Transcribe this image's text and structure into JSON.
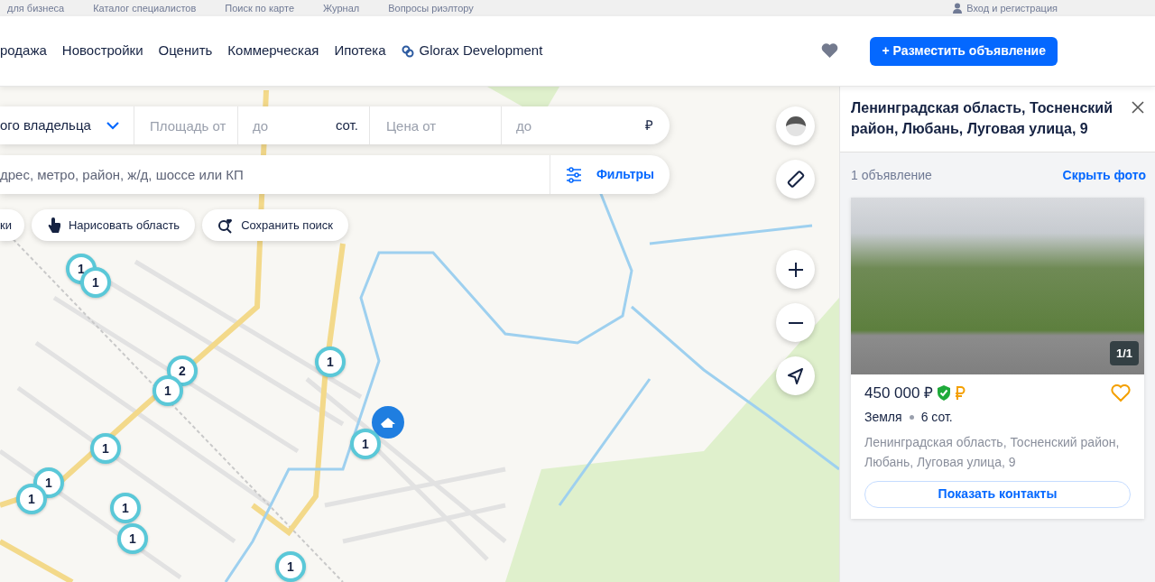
{
  "top_links": [
    "для бизнеса",
    "Каталог специалистов",
    "Поиск по карте",
    "Журнал",
    "Вопросы риэлтору"
  ],
  "login": "Вход и регистрация",
  "nav": [
    {
      "label": "родажа",
      "kind": "text"
    },
    {
      "label": "Новостройки",
      "kind": "text"
    },
    {
      "label": "Оценить",
      "kind": "text"
    },
    {
      "label": "Коммерческая",
      "kind": "text"
    },
    {
      "label": "Ипотека",
      "kind": "text"
    },
    {
      "label": "Glorax Development",
      "kind": "brand"
    }
  ],
  "post_button": "+ Разместить объявление",
  "filters": {
    "owner": "ого владельца",
    "area_from": {
      "placeholder": "Площадь от"
    },
    "area_to": {
      "placeholder": "до"
    },
    "area_unit": "сот.",
    "price_from": {
      "placeholder": "Цена от"
    },
    "price_to": {
      "placeholder": "до"
    },
    "currency": "₽",
    "search_placeholder": "дрес, метро, район, ж/д, шоссе или КП",
    "filters_button": "Фильтры"
  },
  "chips": [
    {
      "label": "ки",
      "kind": "plain"
    },
    {
      "label": "Нарисовать область",
      "kind": "draw"
    },
    {
      "label": "Сохранить поиск",
      "kind": "save"
    }
  ],
  "markers": [
    {
      "count": "1"
    },
    {
      "count": "1"
    },
    {
      "count": "2"
    },
    {
      "count": "1"
    },
    {
      "count": "1"
    },
    {
      "count": "1"
    },
    {
      "count": "1"
    },
    {
      "count": "1"
    },
    {
      "count": "1"
    },
    {
      "count": "1"
    },
    {
      "count": "1"
    },
    {
      "count": "1"
    }
  ],
  "panel": {
    "title": "Ленинградская область, Тосненский район, Любань, Луговая улица, 9",
    "count": "1 объявление",
    "hide_photo": "Скрыть фото",
    "listing": {
      "photo_counter": "1/1",
      "price": "450 000 ₽",
      "verified": true,
      "type": "Земля",
      "area": "6 сот.",
      "address": "Ленинградская область, Тосненский район, Любань, Луговая улица, 9",
      "favorite": false,
      "contacts_button": "Показать контакты"
    }
  }
}
